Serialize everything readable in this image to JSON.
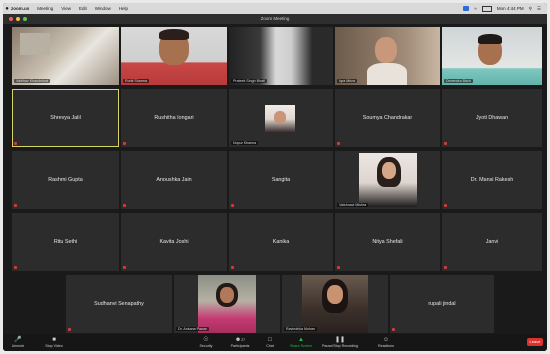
{
  "menubar": {
    "apple": "",
    "app": "zoom.us",
    "items": [
      "Meeting",
      "View",
      "Edit",
      "Window",
      "Help"
    ],
    "clock": "Mon 4:44 PM"
  },
  "window": {
    "title": "Zoom Meeting"
  },
  "participants": {
    "row1": [
      {
        "label": "Vaibhav Khandelwal"
      },
      {
        "label": "Rohit Sharma"
      },
      {
        "label": "Prateek Singh Bhati"
      },
      {
        "label": "Iqra Mirza"
      },
      {
        "label": "Devendra Bisht"
      }
    ],
    "row2": [
      {
        "name": "Shrevya Jalil"
      },
      {
        "name": "Rushitha Iongari"
      },
      {
        "label": "Nupur Khanna"
      },
      {
        "name": "Soumya Chandrakar"
      },
      {
        "name": "Jyoti Dhawan"
      }
    ],
    "row3": [
      {
        "name": "Rashmi Gupta"
      },
      {
        "name": "Anoushka Jain"
      },
      {
        "name": "Sangita"
      },
      {
        "label": "Vaishnavi Mishra"
      },
      {
        "name": "Dr. Mansi Rakesh"
      }
    ],
    "row4": [
      {
        "name": "Ritu Sethi"
      },
      {
        "name": "Kavita Joshi"
      },
      {
        "name": "Kanika"
      },
      {
        "name": "Nitya Shefali"
      },
      {
        "name": "Janvi"
      }
    ],
    "row5": [
      {
        "name": "Sudhanvi Senapathy"
      },
      {
        "label": "Dr. Ankana Pawar"
      },
      {
        "label": "Ravindrika Mohan"
      },
      {
        "name": "rupali jindal"
      }
    ]
  },
  "toolbar": {
    "unmute": "Unmute",
    "start_video": "Stop Video",
    "security": "Security",
    "participants": "Participants",
    "participants_count": "27",
    "chat": "Chat",
    "share_screen": "Share Screen",
    "record": "Pause/Stop Recording",
    "reactions": "Reactions",
    "end": "Leave"
  },
  "colors": {
    "active_speaker": "#d6d36a",
    "share_green": "#2db84b",
    "end_red": "#d9322f"
  }
}
